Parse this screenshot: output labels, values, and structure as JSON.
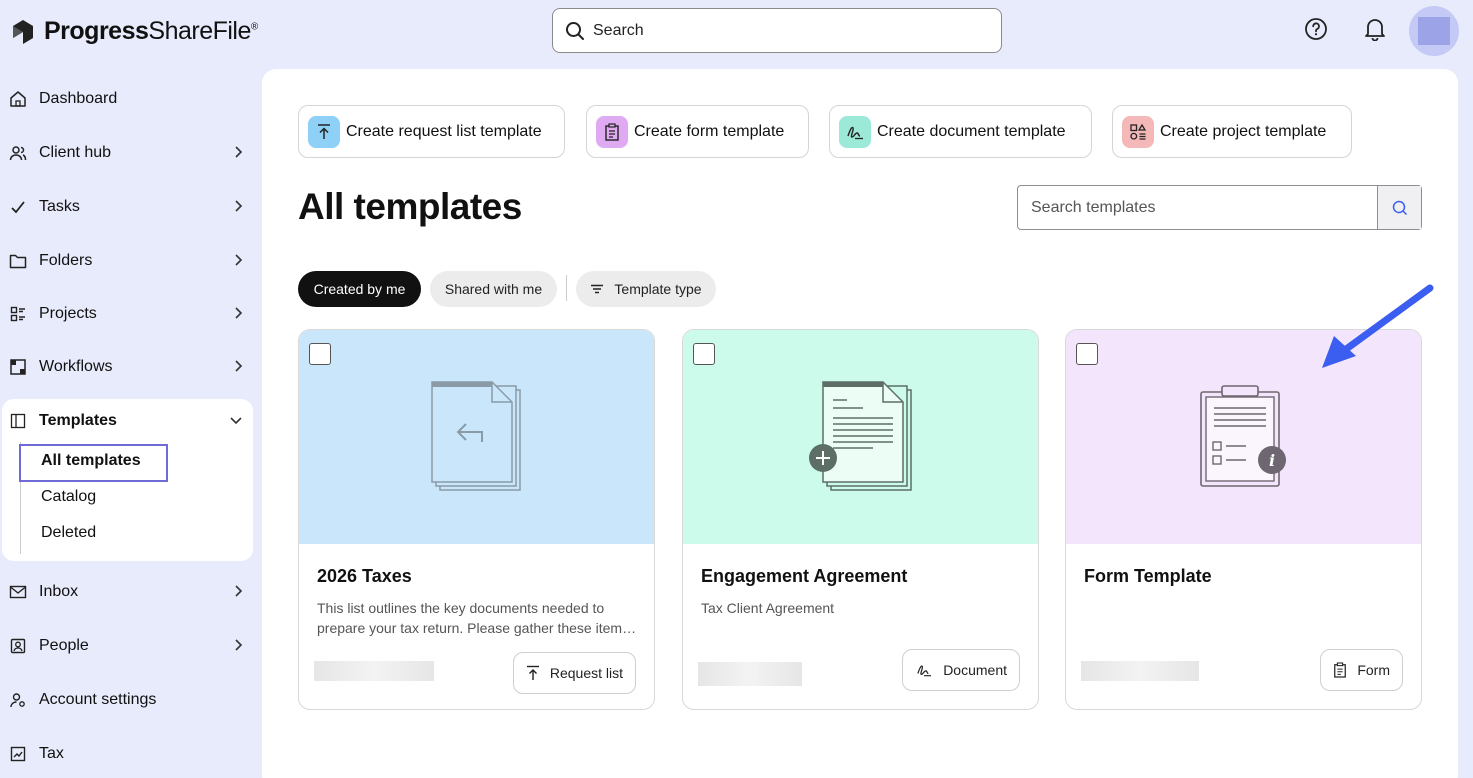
{
  "header": {
    "brand_bold": "Progress",
    "brand_light": "ShareFile",
    "search_placeholder": "Search",
    "help_icon": "help-circle-icon",
    "bell_icon": "bell-icon"
  },
  "sidebar": {
    "items": [
      {
        "label": "Dashboard",
        "icon": "home-icon"
      },
      {
        "label": "Client hub",
        "icon": "users-icon"
      },
      {
        "label": "Tasks",
        "icon": "check-icon"
      },
      {
        "label": "Folders",
        "icon": "folder-icon"
      },
      {
        "label": "Projects",
        "icon": "projects-icon"
      },
      {
        "label": "Workflows",
        "icon": "workflow-icon"
      },
      {
        "label": "Templates",
        "icon": "templates-icon"
      },
      {
        "label": "Inbox",
        "icon": "mail-icon"
      },
      {
        "label": "People",
        "icon": "person-icon"
      },
      {
        "label": "Account settings",
        "icon": "account-icon"
      },
      {
        "label": "Tax",
        "icon": "tax-icon"
      }
    ],
    "templates_sub": [
      "All templates",
      "Catalog",
      "Deleted"
    ]
  },
  "create_buttons": [
    {
      "label": "Create request list template",
      "color": "#8fd0f7"
    },
    {
      "label": "Create form template",
      "color": "#e0aaf3"
    },
    {
      "label": "Create document template",
      "color": "#9be9d6"
    },
    {
      "label": "Create project template",
      "color": "#f4b8b8"
    }
  ],
  "main": {
    "title": "All templates",
    "search_placeholder": "Search templates",
    "filters": {
      "created": "Created by me",
      "shared": "Shared with me",
      "type": "Template type"
    }
  },
  "cards": [
    {
      "title": "2026 Taxes",
      "desc_line1": "This list outlines the key documents needed to",
      "desc_line2": "prepare your tax return. Please gather these items before our meeting.",
      "badge": "Request list",
      "color": "#c9e6fb"
    },
    {
      "title": "Engagement Agreement",
      "desc_line1": "Tax Client Agreement",
      "desc_line2": "",
      "badge": "Document",
      "color": "#ccfbec"
    },
    {
      "title": "Form Template",
      "desc_line1": "",
      "desc_line2": "",
      "badge": "Form",
      "color": "#f3e5fb"
    }
  ],
  "annotation_arrow_color": "#3b5ef0"
}
